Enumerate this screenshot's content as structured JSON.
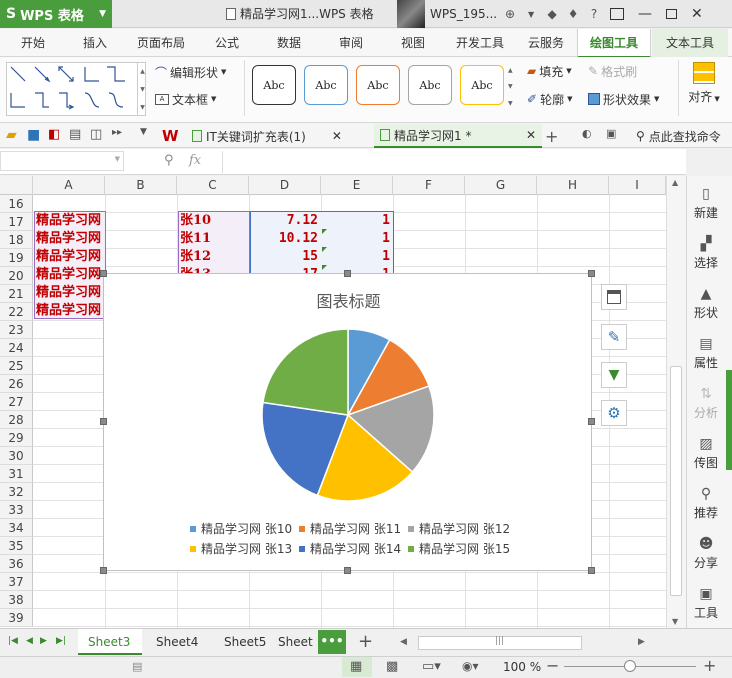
{
  "titlebar": {
    "app_name": "WPS 表格",
    "logo": "S",
    "doc_title": "精品学习网1...WPS 表格",
    "user": "WPS_195..."
  },
  "tabs": [
    "开始",
    "插入",
    "页面布局",
    "公式",
    "数据",
    "审阅",
    "视图",
    "开发工具",
    "云服务",
    "绘图工具",
    "文本工具"
  ],
  "active_tab": "绘图工具",
  "ribbon": {
    "edit_shape": "编辑形状",
    "textbox": "文本框",
    "style_label": "Abc",
    "fill": "填充",
    "format_brush": "格式刷",
    "outline": "轮廓",
    "shape_effect": "形状效果",
    "align": "对齐"
  },
  "style_colors": [
    "#333333",
    "#5b9bd5",
    "#ed7d31",
    "#a5a5a5",
    "#ffc000"
  ],
  "doc_tabs": {
    "tab1": "IT关键词扩充表(1)",
    "tab2": "精品学习网1 *",
    "search": "点此查找命令"
  },
  "formula": {
    "fx": "fx"
  },
  "columns": [
    "A",
    "B",
    "C",
    "D",
    "E",
    "F",
    "G",
    "H",
    "I"
  ],
  "rows": [
    "16",
    "17",
    "18",
    "19",
    "20",
    "21",
    "22",
    "23",
    "24",
    "25",
    "26",
    "27",
    "28",
    "29",
    "30",
    "31",
    "32",
    "33",
    "34",
    "35",
    "36",
    "37",
    "38",
    "39"
  ],
  "cells": {
    "r17": {
      "a": "精品学习网",
      "c": "张10",
      "d": "7.12",
      "e": "1"
    },
    "r18": {
      "a": "精品学习网",
      "c": "张11",
      "d": "10.12",
      "e": "1"
    },
    "r19": {
      "a": "精品学习网",
      "c": "张12",
      "d": "15",
      "e": "1"
    },
    "r20": {
      "a": "精品学习网",
      "c": "张13",
      "d": "17",
      "e": "1"
    },
    "r21": {
      "a": "精品学习网"
    },
    "r22": {
      "a": "精品学习网"
    }
  },
  "chart_data": {
    "type": "pie",
    "title": "图表标题",
    "categories": [
      "精品学习网 张10",
      "精品学习网 张11",
      "精品学习网 张12",
      "精品学习网 张13",
      "精品学习网 张14",
      "精品学习网 张15"
    ],
    "values": [
      7.12,
      10.12,
      15,
      17,
      19,
      20
    ],
    "colors": [
      "#5b9bd5",
      "#ed7d31",
      "#a5a5a5",
      "#ffc000",
      "#4472c4",
      "#70ad47"
    ],
    "legend_position": "bottom"
  },
  "sidebar": [
    "新建",
    "选择",
    "形状",
    "属性",
    "分析",
    "传图",
    "推荐",
    "分享",
    "工具"
  ],
  "sheets": [
    "Sheet3",
    "Sheet4",
    "Sheet5",
    "Sheet"
  ],
  "active_sheet": "Sheet3",
  "status": {
    "zoom": "100 %"
  }
}
